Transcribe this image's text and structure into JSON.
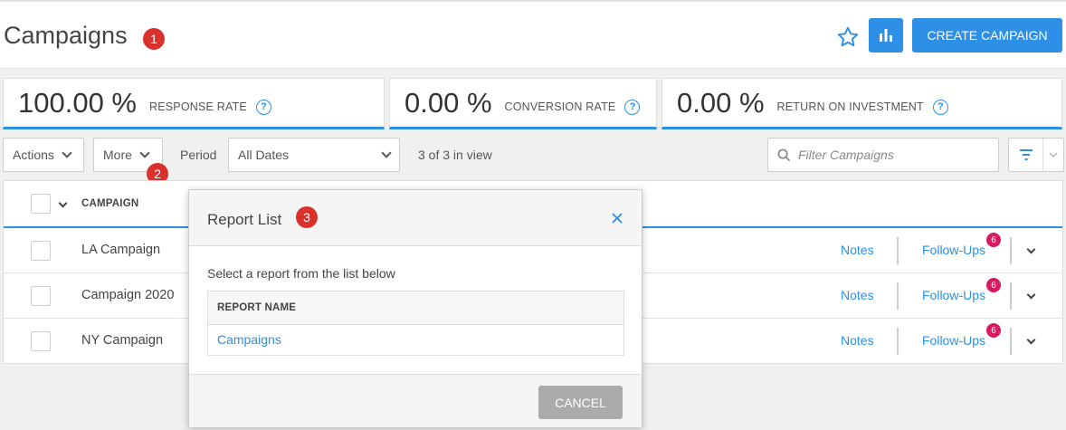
{
  "header": {
    "title": "Campaigns",
    "create_label": "CREATE CAMPAIGN"
  },
  "callouts": [
    "1",
    "2",
    "3"
  ],
  "kpis": [
    {
      "value": "100.00 %",
      "label": "RESPONSE RATE"
    },
    {
      "value": "0.00 %",
      "label": "CONVERSION RATE"
    },
    {
      "value": "0.00 %",
      "label": "RETURN ON INVESTMENT"
    }
  ],
  "toolbar": {
    "actions_label": "Actions",
    "more_label": "More",
    "period_label": "Period",
    "period_value": "All Dates",
    "in_view": "3 of 3 in view",
    "filter_placeholder": "Filter Campaigns"
  },
  "table": {
    "column_campaign": "CAMPAIGN",
    "rows": [
      {
        "name": "LA Campaign",
        "notes": "Notes",
        "followups": "Follow-Ups",
        "followups_count": "6"
      },
      {
        "name": "Campaign 2020",
        "notes": "Notes",
        "followups": "Follow-Ups",
        "followups_count": "6"
      },
      {
        "name": "NY Campaign",
        "notes": "Notes",
        "followups": "Follow-Ups",
        "followups_count": "6"
      }
    ]
  },
  "modal": {
    "title": "Report List",
    "instruction": "Select a report from the list below",
    "column_header": "REPORT NAME",
    "reports": [
      "Campaigns"
    ],
    "cancel_label": "CANCEL"
  },
  "colors": {
    "accent": "#2d8fe6",
    "callout_badge": "#d9312b",
    "count_badge": "#d81b60",
    "cancel_button": "#aaaaaa"
  },
  "icons": [
    "star-icon",
    "bar-chart-icon",
    "help-icon",
    "search-icon",
    "filter-icon",
    "close-icon",
    "chevron-down-icon"
  ]
}
